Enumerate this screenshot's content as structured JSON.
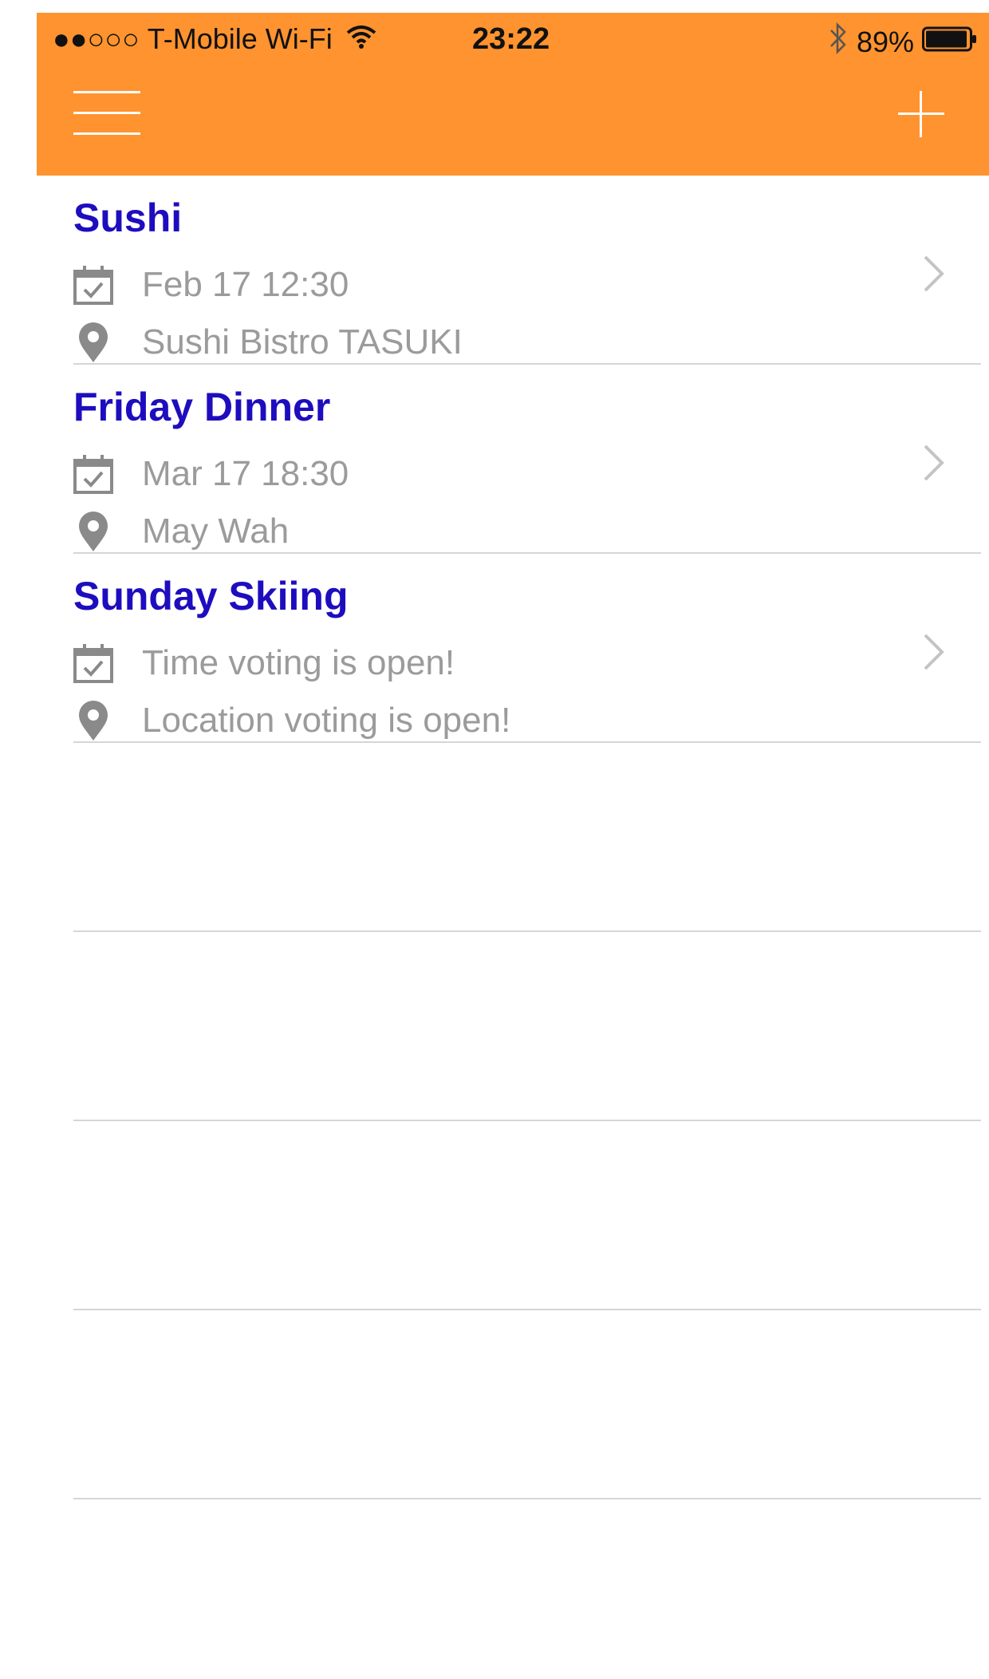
{
  "status_bar": {
    "signal": "●●○○○",
    "carrier": "T-Mobile Wi-Fi",
    "time": "23:22",
    "battery": "89%",
    "icons": [
      "wifi-icon",
      "bluetooth-icon",
      "battery-icon"
    ]
  },
  "nav": {
    "menu_icon": "hamburger-menu-icon",
    "add_icon": "plus-icon",
    "bar_color": "#fe932f"
  },
  "events": [
    {
      "title": "Sushi",
      "time": "Feb 17 12:30",
      "location": "Sushi Bistro TASUKI"
    },
    {
      "title": "Friday Dinner",
      "time": "Mar 17 18:30",
      "location": "May Wah"
    },
    {
      "title": "Sunday Skiing",
      "time": "Time voting is open!",
      "location": "Location voting is open!"
    }
  ],
  "colors": {
    "title": "#1e0dbf",
    "detail_text": "#9b9b9b",
    "divider": "#d6d6d6"
  }
}
